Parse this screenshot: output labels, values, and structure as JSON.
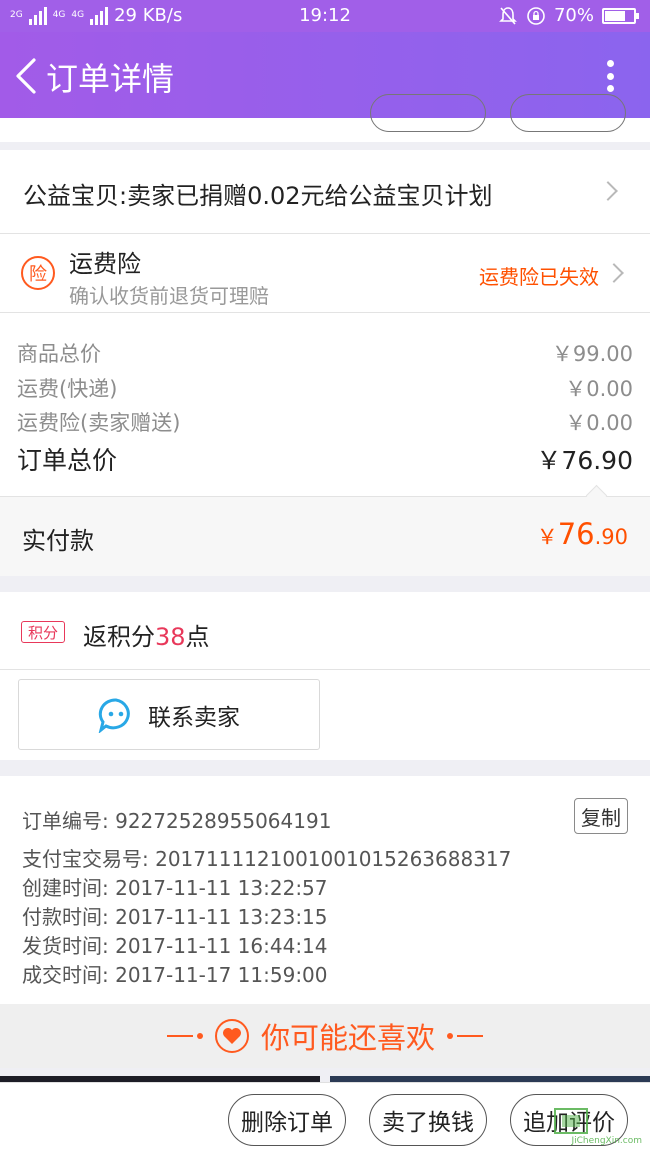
{
  "status_bar": {
    "net_tag_1": "2G",
    "net_tag_2": "4G",
    "net_tag_3": "4G",
    "speed": "29 KB/s",
    "time": "19:12",
    "battery": "70%",
    "battery_level": 0.7
  },
  "header": {
    "title": "订单详情"
  },
  "charity": {
    "text": "公益宝贝:卖家已捐赠0.02元给公益宝贝计划"
  },
  "insurance": {
    "icon_char": "险",
    "title": "运费险",
    "subtitle": "确认收货前退货可理赔",
    "status": "运费险已失效"
  },
  "prices": [
    {
      "label": "商品总价",
      "value": "￥99.00"
    },
    {
      "label": "运费(快递)",
      "value": "￥0.00"
    },
    {
      "label": "运费险(卖家赠送)",
      "value": "￥0.00"
    }
  ],
  "order_total": {
    "label": "订单总价",
    "value": "￥76.90"
  },
  "paid": {
    "label": "实付款",
    "currency": "￥",
    "integer": "76",
    "decimal": ".90"
  },
  "points": {
    "tag": "积分",
    "prefix": "返积分",
    "amount": "38",
    "suffix": "点"
  },
  "contact": {
    "label": "联系卖家"
  },
  "order_info": {
    "lines": [
      "订单编号: 92272528955064191",
      "支付宝交易号: 2017111121001001015263688317",
      "创建时间: 2017-11-11 13:22:57",
      "付款时间: 2017-11-11 13:23:15",
      "发货时间: 2017-11-11 16:44:14",
      "成交时间: 2017-11-17 11:59:00"
    ],
    "copy_label": "复制"
  },
  "recommend": {
    "title": "你可能还喜欢"
  },
  "actions": {
    "delete": "删除订单",
    "sell": "卖了换钱",
    "review": "追加评价"
  },
  "watermark": {
    "text": "JiChengXin.com"
  },
  "colors": {
    "header_purple": "#a15fe8",
    "accent_orange": "#ff5000",
    "points_pink": "#e8385a",
    "contact_icon_blue": "#29a8e6"
  }
}
